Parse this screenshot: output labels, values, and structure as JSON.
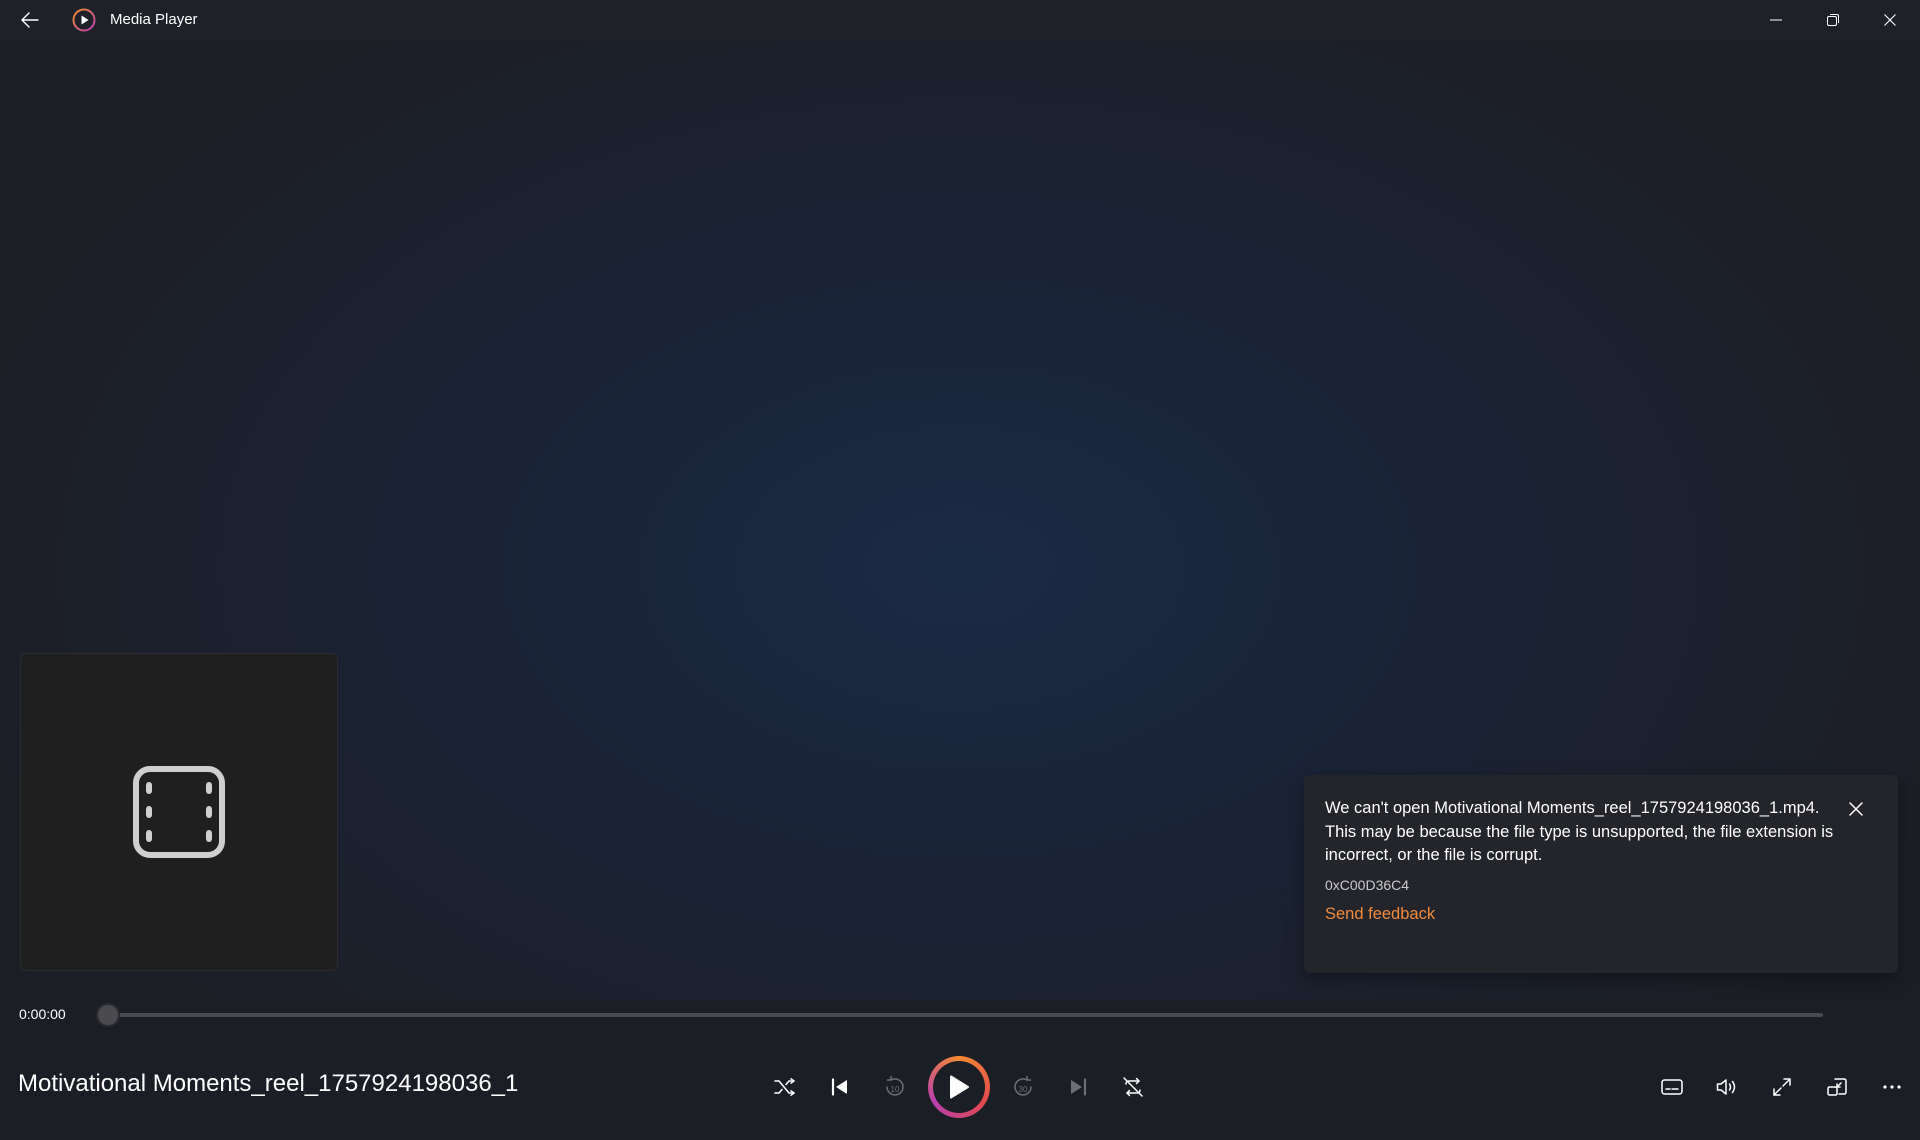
{
  "app": {
    "title": "Media Player",
    "accent_color": "#f08a3e"
  },
  "titlebar": {
    "back_icon": "back-arrow-icon",
    "logo_icon": "media-player-logo-icon",
    "minimize_icon": "minimize-icon",
    "restore_icon": "restore-icon",
    "close_icon": "close-icon"
  },
  "thumbnail": {
    "icon": "film-icon"
  },
  "error_toast": {
    "message": "We can't open Motivational Moments_reel_1757924198036_1.mp4. This may be because the file type is unsupported, the file extension is incorrect, or the file is corrupt.",
    "error_code": "0xC00D36C4",
    "feedback_link": "Send feedback",
    "close_icon": "dismiss-icon"
  },
  "playback": {
    "current_time": "0:00:00",
    "progress": 0
  },
  "now_playing": {
    "title": "Motivational Moments_reel_1757924198036_1"
  },
  "controls": {
    "shuffle": "shuffle-icon",
    "previous": "previous-track-icon",
    "rewind": "skip-back-10-icon",
    "rewind_label": "10",
    "play": "play-icon",
    "forward": "skip-forward-30-icon",
    "forward_label": "30",
    "next": "next-track-icon",
    "repeat": "repeat-off-icon",
    "subtitles": "subtitles-icon",
    "volume": "volume-icon",
    "fullscreen": "fullscreen-icon",
    "miniplayer": "miniplayer-icon",
    "more": "more-options-icon"
  }
}
